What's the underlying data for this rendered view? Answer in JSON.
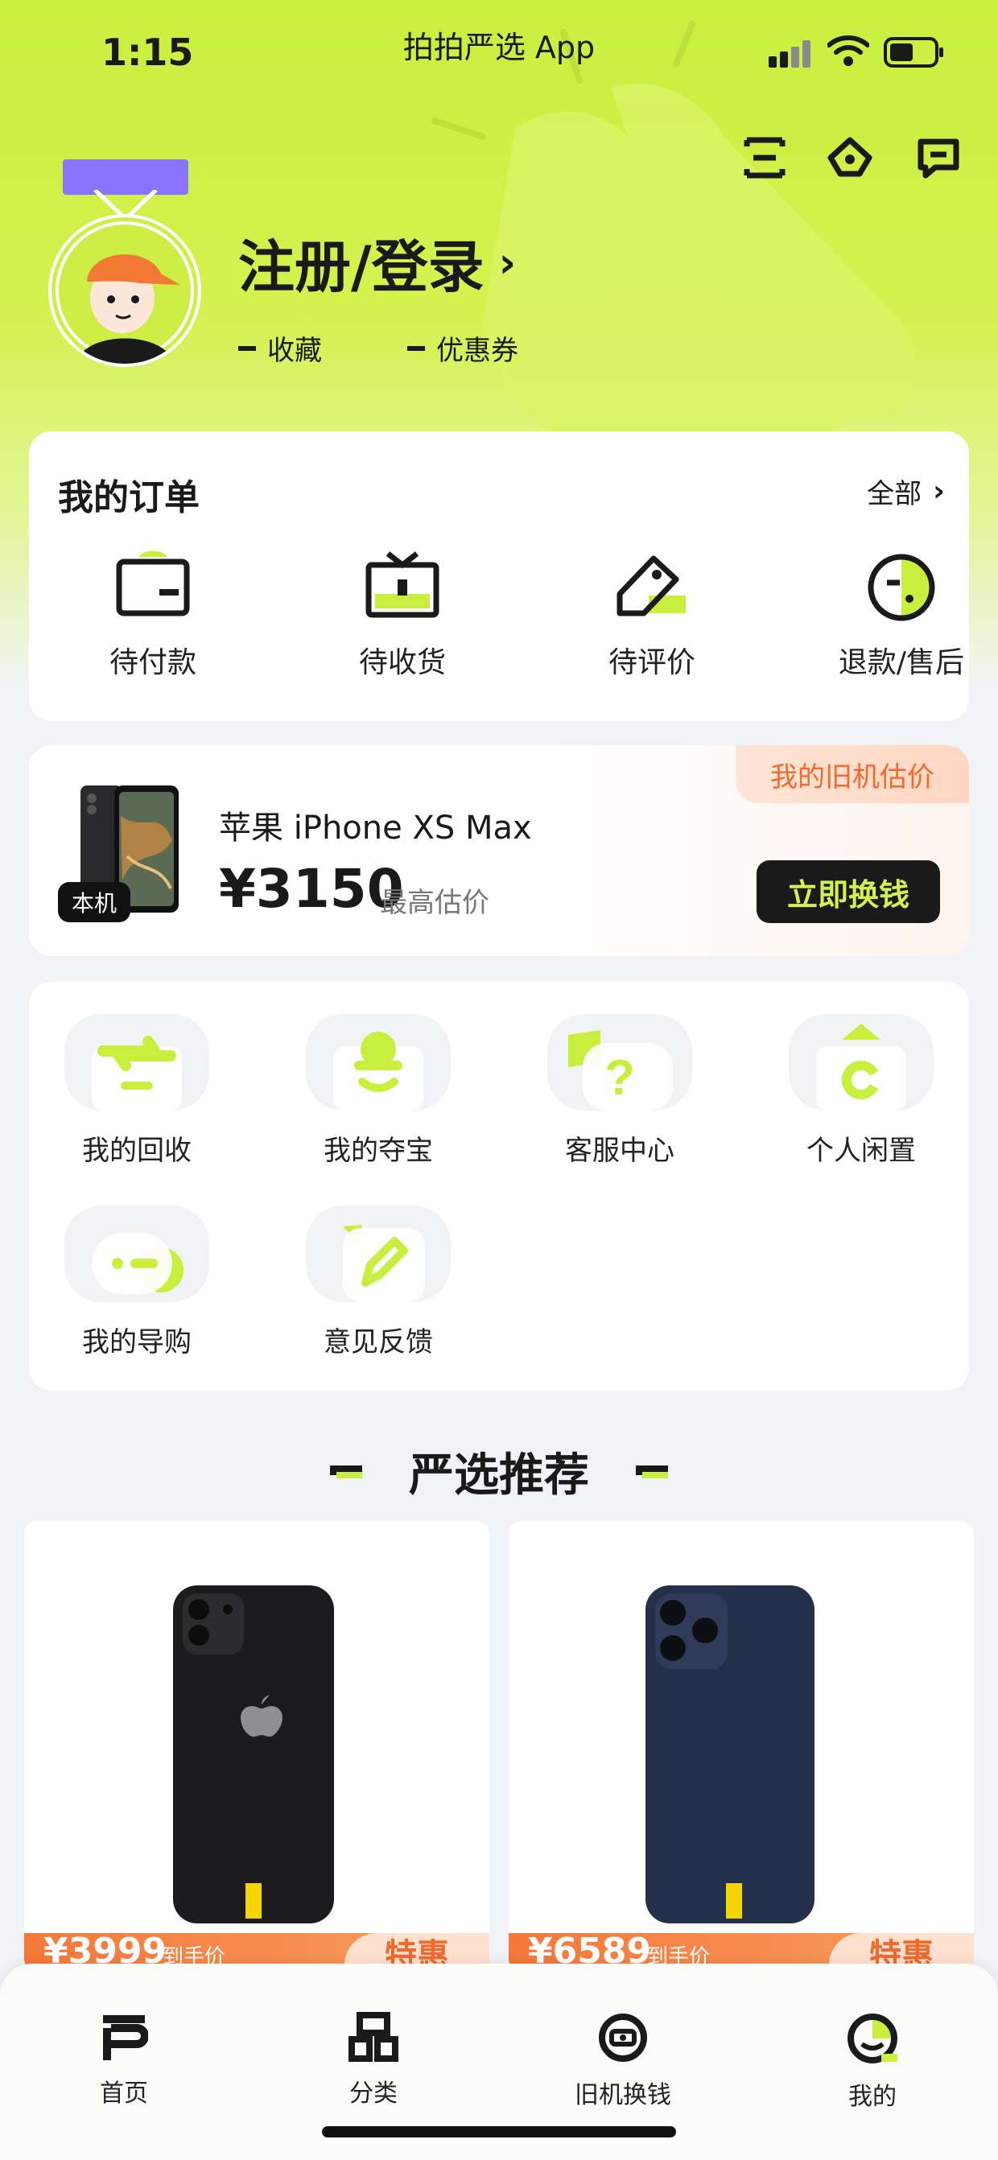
{
  "status_bar": {
    "time": "1:15",
    "app_name": "拍拍严选 App"
  },
  "header": {
    "icons": [
      "scan-icon",
      "service-icon",
      "message-icon"
    ]
  },
  "profile": {
    "login_label": "注册/登录",
    "favorites_label": "收藏",
    "coupons_label": "优惠券"
  },
  "orders": {
    "title": "我的订单",
    "all_label": "全部",
    "items": [
      {
        "label": "待付款",
        "icon": "wallet-icon"
      },
      {
        "label": "待收货",
        "icon": "tv-box-icon"
      },
      {
        "label": "待评价",
        "icon": "tag-pen-icon"
      },
      {
        "label": "退款/售后",
        "icon": "refund-icon"
      }
    ]
  },
  "trade_in": {
    "tag": "我的旧机估价",
    "badge": "本机",
    "model": "苹果 iPhone XS Max",
    "price": "¥3150",
    "price_label": "最高估价",
    "button": "立即换钱"
  },
  "services": [
    {
      "label": "我的回收",
      "icon": "recycle-icon"
    },
    {
      "label": "我的夺宝",
      "icon": "treasure-icon"
    },
    {
      "label": "客服中心",
      "icon": "help-icon"
    },
    {
      "label": "个人闲置",
      "icon": "idle-icon"
    },
    {
      "label": "我的导购",
      "icon": "guide-icon"
    },
    {
      "label": "意见反馈",
      "icon": "feedback-icon"
    }
  ],
  "recommend": {
    "title": "严选推荐",
    "products": [
      {
        "price": "¥3999",
        "price_label": "到手价",
        "deal": "特惠",
        "color": "#1c1c1e"
      },
      {
        "price": "¥6589",
        "price_label": "到手价",
        "deal": "特惠",
        "color": "#25304a"
      }
    ]
  },
  "tabbar": {
    "items": [
      {
        "label": "首页",
        "icon": "home-icon"
      },
      {
        "label": "分类",
        "icon": "category-icon"
      },
      {
        "label": "旧机换钱",
        "icon": "trade-in-icon"
      },
      {
        "label": "我的",
        "icon": "profile-icon"
      }
    ]
  },
  "colors": {
    "accent": "#c9ef3e",
    "dark": "#1a1a1a",
    "orange": "#f06a2e",
    "purple": "#8a73ff"
  }
}
